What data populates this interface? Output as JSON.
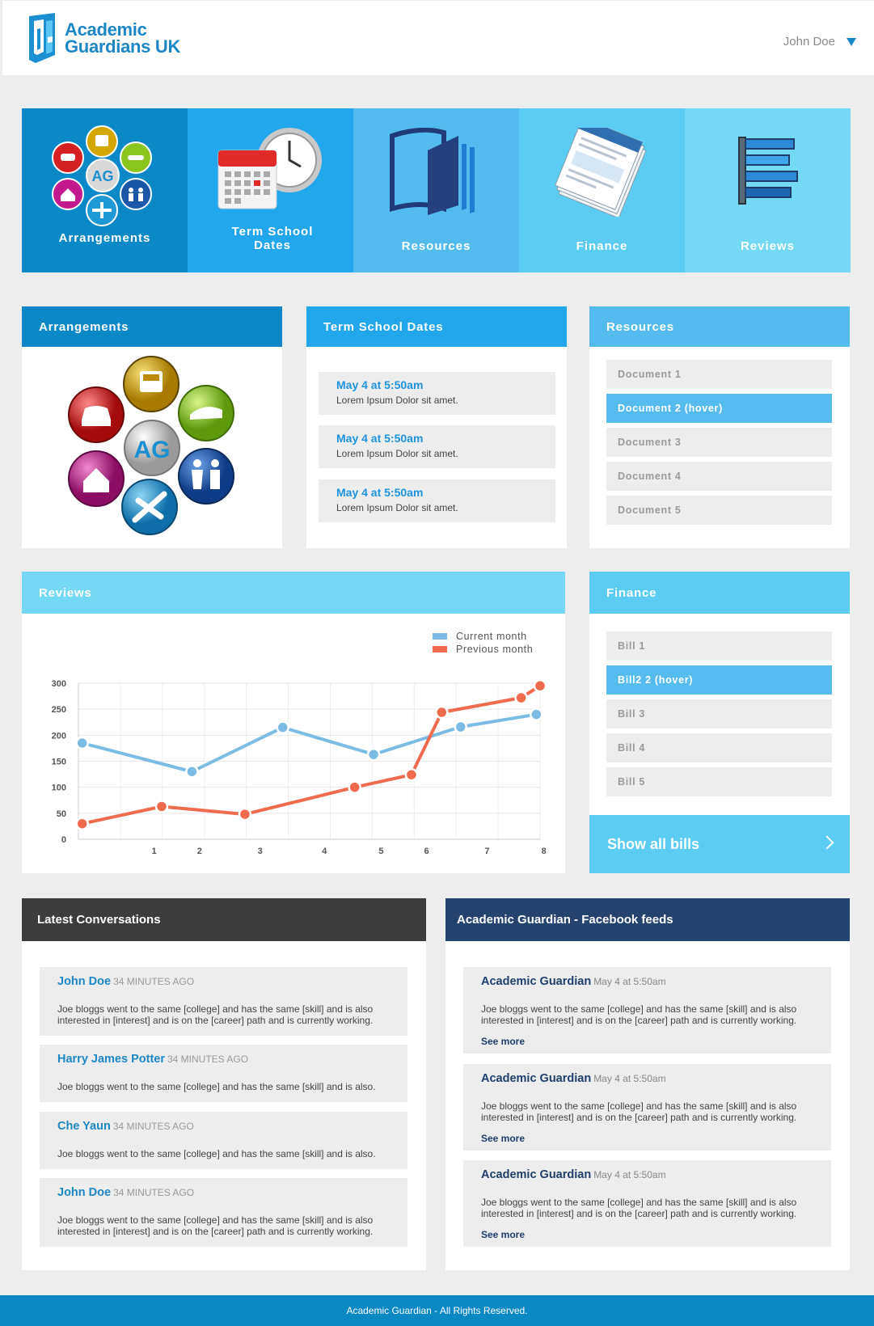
{
  "brand": {
    "line1": "Academic",
    "line2": "Guardians UK",
    "logo_icon": "ag-shield-logo"
  },
  "user": {
    "name": "John Doe",
    "menu_icon": "caret-down-icon"
  },
  "tiles": [
    {
      "label": "Arrangements",
      "icon": "arrangements-icon",
      "color": "#0a88c8"
    },
    {
      "label": "Term School Dates",
      "icon": "calendar-clock-icon",
      "color": "#22a6ec"
    },
    {
      "label": "Resources",
      "icon": "book-icon",
      "color": "#54bbef"
    },
    {
      "label": "Finance",
      "icon": "invoice-icon",
      "color": "#5bcdf2"
    },
    {
      "label": "Reviews",
      "icon": "bar-chart-icon",
      "color": "#75d8f4"
    }
  ],
  "arrangements": {
    "title": "Arrangements",
    "color": "#0a88c8"
  },
  "term_dates": {
    "title": "Term School Dates",
    "color": "#22a6ec",
    "events": [
      {
        "when": "May 4 at 5:50am",
        "what": "Lorem Ipsum Dolor sit amet."
      },
      {
        "when": "May 4 at 5:50am",
        "what": "Lorem Ipsum Dolor sit amet."
      },
      {
        "when": "May 4 at 5:50am",
        "what": "Lorem Ipsum Dolor sit amet."
      }
    ]
  },
  "resources": {
    "title": "Resources",
    "color": "#54bbef",
    "documents": [
      "Document 1",
      "Document 2 (hover)",
      "Document 3",
      "Document 4",
      "Document 5"
    ]
  },
  "reviews": {
    "title": "Reviews",
    "color": "#75d8f4"
  },
  "chart_data": {
    "type": "line",
    "x": [
      0.1,
      2,
      3.2,
      4.8,
      6.5,
      8,
      9.2,
      10.8,
      12.3
    ],
    "x_tick_labels": [
      "1",
      "2",
      "3",
      "4",
      "5",
      "6",
      "7",
      "8"
    ],
    "xlim": [
      0,
      12.2
    ],
    "ylim": [
      0,
      300
    ],
    "y_ticks": [
      0,
      50,
      100,
      150,
      200,
      250,
      300
    ],
    "grid": true,
    "legend": "top-right",
    "series": [
      {
        "name": "Current month",
        "color": "#7cbbe4",
        "points": [
          [
            0.1,
            185
          ],
          [
            3,
            130
          ],
          [
            5.4,
            215
          ],
          [
            7.8,
            163
          ],
          [
            10.1,
            216
          ],
          [
            12.1,
            240
          ]
        ]
      },
      {
        "name": "Previous month",
        "color": "#f06a4e",
        "points": [
          [
            0.1,
            30
          ],
          [
            2.2,
            63
          ],
          [
            4.4,
            48
          ],
          [
            7.3,
            100
          ],
          [
            8.8,
            124
          ],
          [
            9.6,
            244
          ],
          [
            11.7,
            272
          ],
          [
            12.2,
            295
          ]
        ]
      }
    ]
  },
  "finance": {
    "title": "Finance",
    "color": "#5bcdf2",
    "bills": [
      "Bill 1",
      "Bill2 2 (hover)",
      "Bill 3",
      "Bill 4",
      "Bill 5"
    ],
    "show_all": "Show all bills"
  },
  "conversations": {
    "title": "Latest Conversations",
    "color": "#3d3d3d",
    "items": [
      {
        "who": "John Doe",
        "ago": "34 MINUTES AGO",
        "msg": "Joe bloggs went to the same [college] and has the same [skill] and is also interested in [interest] and is on the [career] path and is currently working."
      },
      {
        "who": "Harry James Potter",
        "ago": "34 MINUTES AGO",
        "msg": "Joe bloggs went to the same [college] and has the same [skill] and is also."
      },
      {
        "who": "Che Yaun",
        "ago": "34 MINUTES AGO",
        "msg": "Joe bloggs went to the same [college] and has the same [skill] and is also."
      },
      {
        "who": "John Doe",
        "ago": "34 MINUTES AGO",
        "msg": "Joe bloggs went to the same [college] and has the same [skill] and is also interested in [interest] and is on the [career] path and is currently working."
      }
    ]
  },
  "facebook": {
    "title": "Academic Guardian - Facebook feeds",
    "color": "#25436f",
    "items": [
      {
        "who": "Academic Guardian",
        "ago": "May 4 at 5:50am",
        "msg": "Joe bloggs went to the same [college] and has the same [skill] and is also interested in [interest] and is on the [career] path and is currently working.",
        "more": "See more"
      },
      {
        "who": "Academic Guardian",
        "ago": "May 4 at 5:50am",
        "msg": "Joe bloggs went to the same [college] and has the same [skill] and is also interested in [interest] and is on the [career] path and is currently working.",
        "more": "See more"
      },
      {
        "who": "Academic Guardian",
        "ago": "May 4 at 5:50am",
        "msg": "Joe bloggs went to the same [college] and has the same [skill] and is also interested in [interest] and is on the [career] path and is currently working.",
        "more": "See more"
      }
    ]
  },
  "footer": {
    "text": "Academic Guardian - All Rights Reserved."
  }
}
